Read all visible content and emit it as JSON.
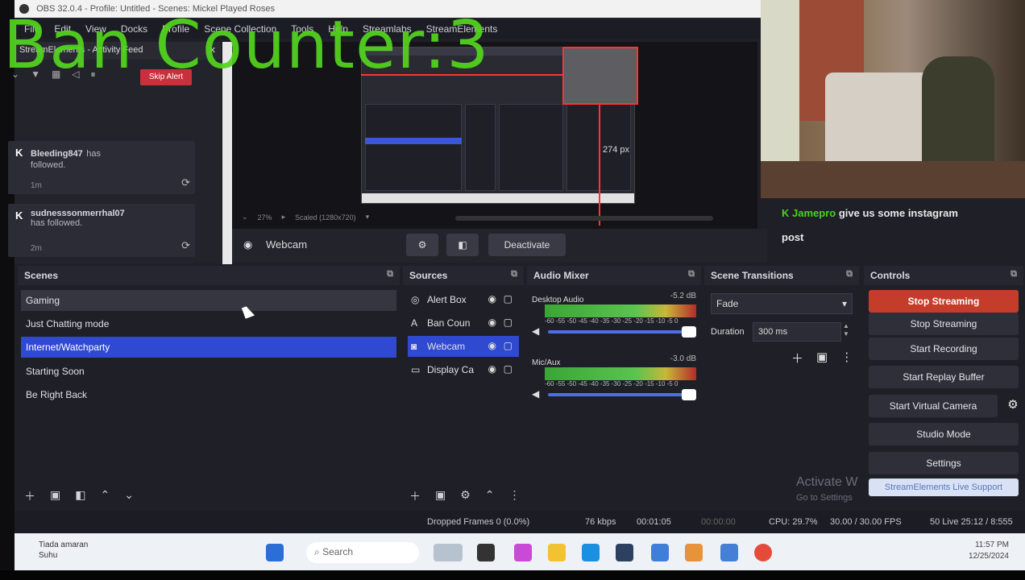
{
  "window": {
    "title": "OBS 32.0.4 - Profile: Untitled - Scenes: Mickel Played Roses",
    "menu": [
      "File",
      "Edit",
      "View",
      "Docks",
      "Profile",
      "Scene Collection",
      "Tools",
      "Help",
      "Streamlabs",
      "StreamElements"
    ]
  },
  "overlay": {
    "ban_counter": "Ban Counter:3"
  },
  "alerts": {
    "dock_title": "StreamElements - Activity Feed",
    "skip_label": "Skip Alert",
    "items": [
      {
        "name": "Bleeding847",
        "msg_line1": "has",
        "msg_line2": "followed.",
        "time": "1m"
      },
      {
        "name": "sudnesssonmerrhal07",
        "msg_line1": "has followed.",
        "msg_line2": "",
        "time": "2m"
      }
    ]
  },
  "preview": {
    "px_label": "274 px",
    "zoom": "27%",
    "zoom_mode": "Scaled (1280x720)"
  },
  "chat": {
    "user": "Jamepro",
    "text": "give us some instagram",
    "text2": "post"
  },
  "source_toolbar": {
    "source_name": "Webcam",
    "deactivate_label": "Deactivate"
  },
  "scenes": {
    "title": "Scenes",
    "items": [
      "Gaming",
      "Just Chatting mode",
      "Internet/Watchparty",
      "Starting Soon",
      "Be Right Back"
    ],
    "selected": 2
  },
  "sources": {
    "title": "Sources",
    "items": [
      {
        "label": "Alert Box",
        "icon": "globe-icon"
      },
      {
        "label": "Ban Coun",
        "icon": "text-icon"
      },
      {
        "label": "Webcam",
        "icon": "camera-icon"
      },
      {
        "label": "Display Ca",
        "icon": "monitor-icon"
      }
    ]
  },
  "mixer": {
    "title": "Audio Mixer",
    "channels": [
      {
        "name": "Desktop Audio",
        "db": "-5.2 dB"
      },
      {
        "name": "Mic/Aux",
        "db": "-3.0 dB"
      }
    ],
    "scale": "-60 -55 -50 -45 -40 -35 -30 -25 -20 -15 -10 -5 0"
  },
  "transitions": {
    "title": "Scene Transitions",
    "selected": "Fade",
    "duration_label": "Duration",
    "duration_value": "300 ms"
  },
  "controls": {
    "title": "Controls",
    "buttons": [
      "Stop Streaming",
      "Stop Streaming",
      "Start Recording",
      "Start Replay Buffer",
      "Start Virtual Camera",
      "Studio Mode",
      "Settings",
      "StreamElements Live Support"
    ]
  },
  "activation": {
    "line1": "Activate W",
    "line2": "Go to Settings"
  },
  "status": {
    "dropped": "Dropped Frames 0 (0.0%)",
    "kbps": "76 kbps",
    "rec_time": "00:01:05",
    "live_time": "00:00:00",
    "cpu": "CPU: 29.7%",
    "fps": "30.00 / 30.00 FPS",
    "live": "50 Live 25:12 / 8:555"
  },
  "taskbar": {
    "weather_line1": "Tiada amaran",
    "weather_line2": "Suhu",
    "search_placeholder": "Search",
    "time": "11:57 PM",
    "date": "12/25/2024"
  },
  "colors": {
    "ban_counter": "#53d61e",
    "selected": "#2f49d1",
    "live_button": "#c43d2b",
    "chat_tag": "#43d61b"
  }
}
